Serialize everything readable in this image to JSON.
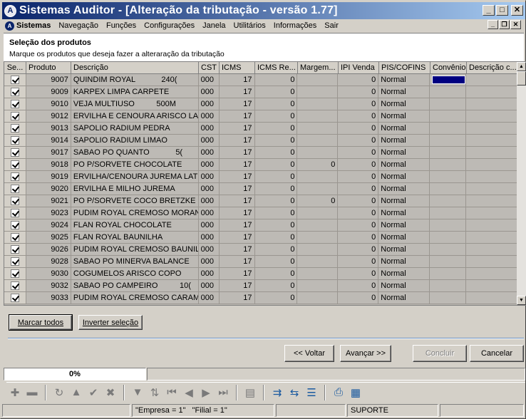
{
  "window": {
    "title": "Sistemas Auditor - [Alteração da tributação - versão 1.77]",
    "min": "_",
    "max": "□",
    "close": "✕"
  },
  "menu": [
    "Sistemas",
    "Navegação",
    "Funções",
    "Configurações",
    "Janela",
    "Utilitários",
    "Informações",
    "Sair"
  ],
  "header": {
    "title": "Seleção dos produtos",
    "subtitle": "Marque os produtos que deseja fazer a alteraração da tributação"
  },
  "grid": {
    "columns": [
      "Se...",
      "Produto",
      "Descrição",
      "CST",
      "ICMS",
      "ICMS Re...",
      "Margem...",
      "IPI Venda",
      "PIS/COFINS",
      "Convênio",
      "Descrição c..."
    ],
    "rows": [
      {
        "code": "9007",
        "desc": "QUINDIM ROYAL            240(",
        "cst": "000",
        "icms": "17",
        "icmsre": "0",
        "margem": "",
        "ipi": "0",
        "pis": "Normal"
      },
      {
        "code": "9009",
        "desc": "KARPEX LIMPA CARPETE",
        "cst": "000",
        "icms": "17",
        "icmsre": "0",
        "margem": "",
        "ipi": "0",
        "pis": "Normal"
      },
      {
        "code": "9010",
        "desc": "VEJA MULTIUSO          500M",
        "cst": "000",
        "icms": "17",
        "icmsre": "0",
        "margem": "",
        "ipi": "0",
        "pis": "Normal"
      },
      {
        "code": "9012",
        "desc": "ERVILHA E CENOURA ARISCO LA",
        "cst": "000",
        "icms": "17",
        "icmsre": "0",
        "margem": "",
        "ipi": "0",
        "pis": "Normal"
      },
      {
        "code": "9013",
        "desc": "SAPOLIO RADIUM PEDRA",
        "cst": "000",
        "icms": "17",
        "icmsre": "0",
        "margem": "",
        "ipi": "0",
        "pis": "Normal"
      },
      {
        "code": "9014",
        "desc": "SAPOLIO RADIUM LIMAO",
        "cst": "000",
        "icms": "17",
        "icmsre": "0",
        "margem": "",
        "ipi": "0",
        "pis": "Normal"
      },
      {
        "code": "9017",
        "desc": "SABAO PO QUANTO            5(",
        "cst": "000",
        "icms": "17",
        "icmsre": "0",
        "margem": "",
        "ipi": "0",
        "pis": "Normal"
      },
      {
        "code": "9018",
        "desc": "PO P/SORVETE CHOCOLATE",
        "cst": "000",
        "icms": "17",
        "icmsre": "0",
        "margem": "0",
        "ipi": "0",
        "pis": "Normal"
      },
      {
        "code": "9019",
        "desc": "ERVILHA/CENOURA JUREMA LAT",
        "cst": "000",
        "icms": "17",
        "icmsre": "0",
        "margem": "",
        "ipi": "0",
        "pis": "Normal"
      },
      {
        "code": "9020",
        "desc": "ERVILHA E MILHO JUREMA",
        "cst": "000",
        "icms": "17",
        "icmsre": "0",
        "margem": "",
        "ipi": "0",
        "pis": "Normal"
      },
      {
        "code": "9021",
        "desc": "PO P/SORVETE COCO BRETZKE",
        "cst": "000",
        "icms": "17",
        "icmsre": "0",
        "margem": "0",
        "ipi": "0",
        "pis": "Normal"
      },
      {
        "code": "9023",
        "desc": "PUDIM ROYAL CREMOSO MORAN",
        "cst": "000",
        "icms": "17",
        "icmsre": "0",
        "margem": "",
        "ipi": "0",
        "pis": "Normal"
      },
      {
        "code": "9024",
        "desc": "FLAN ROYAL CHOCOLATE",
        "cst": "000",
        "icms": "17",
        "icmsre": "0",
        "margem": "",
        "ipi": "0",
        "pis": "Normal"
      },
      {
        "code": "9025",
        "desc": "FLAN ROYAL BAUNILHA",
        "cst": "000",
        "icms": "17",
        "icmsre": "0",
        "margem": "",
        "ipi": "0",
        "pis": "Normal"
      },
      {
        "code": "9026",
        "desc": "PUDIM ROYAL CREMOSO BAUNIL",
        "cst": "000",
        "icms": "17",
        "icmsre": "0",
        "margem": "",
        "ipi": "0",
        "pis": "Normal"
      },
      {
        "code": "9028",
        "desc": "SABAO PO MINERVA BALANCE",
        "cst": "000",
        "icms": "17",
        "icmsre": "0",
        "margem": "",
        "ipi": "0",
        "pis": "Normal"
      },
      {
        "code": "9030",
        "desc": "COGUMELOS ARISCO COPO",
        "cst": "000",
        "icms": "17",
        "icmsre": "0",
        "margem": "",
        "ipi": "0",
        "pis": "Normal"
      },
      {
        "code": "9032",
        "desc": "SABAO PO CAMPEIRO          10(",
        "cst": "000",
        "icms": "17",
        "icmsre": "0",
        "margem": "",
        "ipi": "0",
        "pis": "Normal"
      },
      {
        "code": "9033",
        "desc": "PUDIM ROYAL CREMOSO CARAM",
        "cst": "000",
        "icms": "17",
        "icmsre": "0",
        "margem": "",
        "ipi": "0",
        "pis": "Normal"
      }
    ]
  },
  "buttons": {
    "mark_all": "Marcar todos",
    "invert": "Inverter seleção",
    "back": "<< Voltar",
    "next": "Avançar >>",
    "finish": "Concluir",
    "cancel": "Cancelar"
  },
  "progress": {
    "value": "0%",
    "fraction": 0
  },
  "status": {
    "empresa": "\"Empresa = 1\"",
    "filial": "\"Filial = 1\"",
    "user": "SUPORTE"
  },
  "colors": {
    "title_start": "#0a246a",
    "title_end": "#a6caf0",
    "selection": "#000080"
  }
}
